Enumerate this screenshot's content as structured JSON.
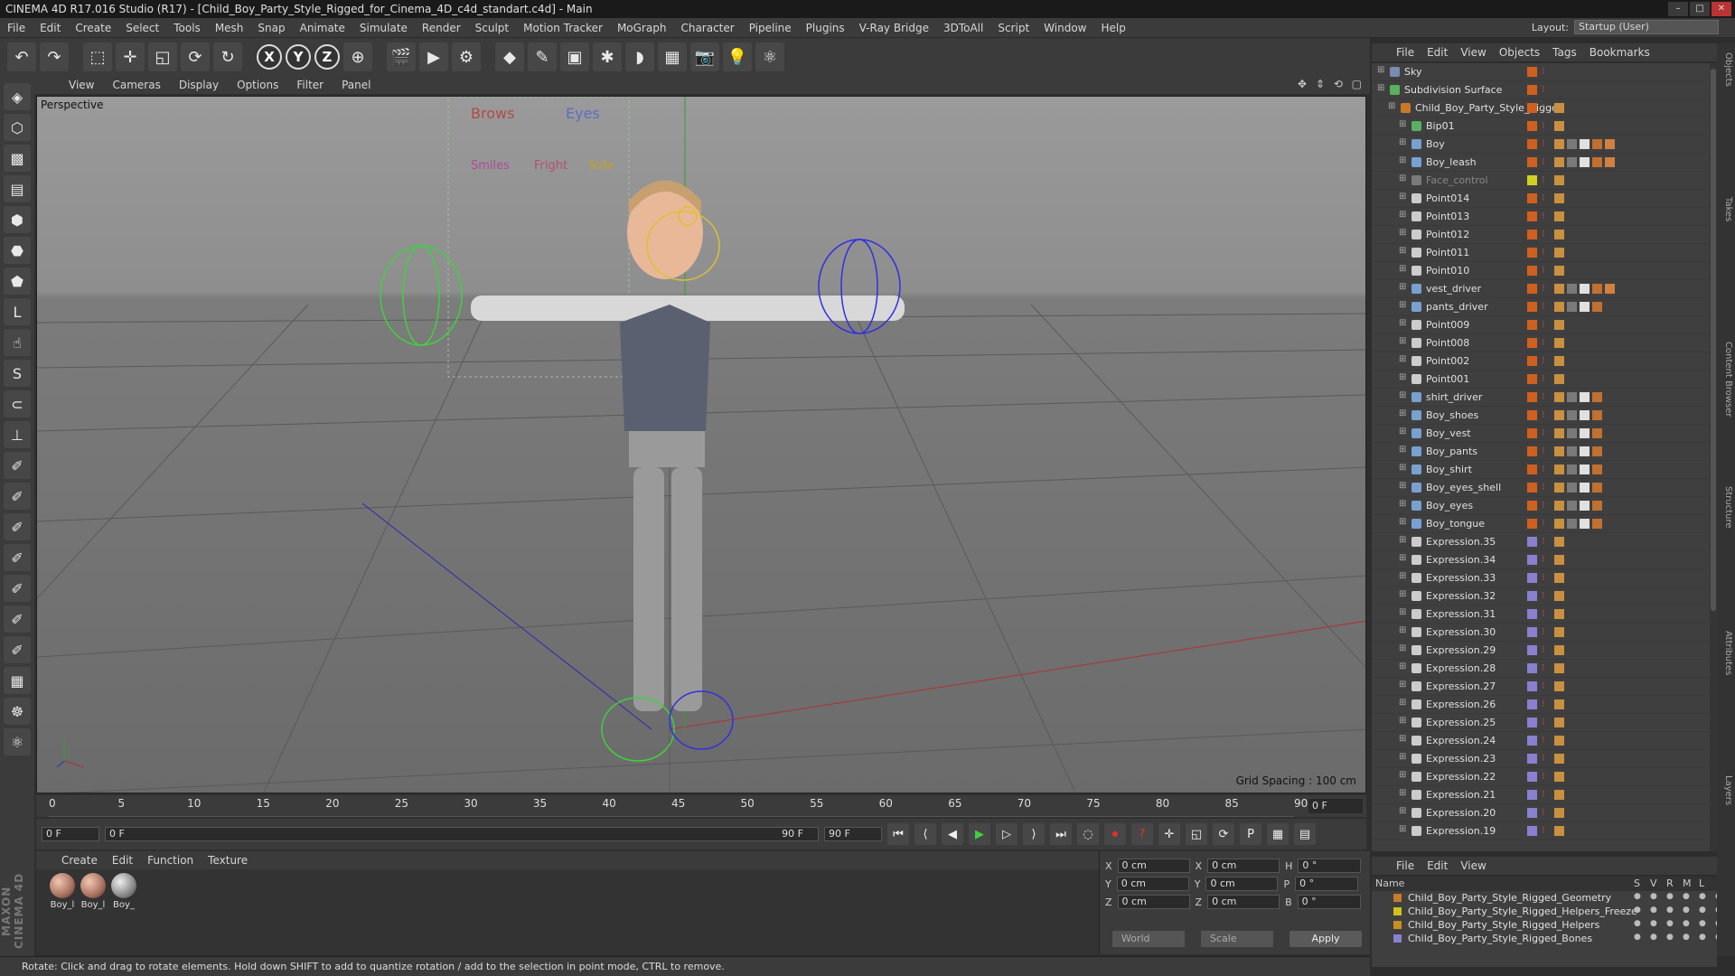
{
  "title": "CINEMA 4D R17.016 Studio (R17) - [Child_Boy_Party_Style_Rigged_for_Cinema_4D_c4d_standart.c4d] - Main",
  "menu": [
    "File",
    "Edit",
    "Create",
    "Select",
    "Tools",
    "Mesh",
    "Snap",
    "Animate",
    "Simulate",
    "Render",
    "Sculpt",
    "Motion Tracker",
    "MoGraph",
    "Character",
    "Pipeline",
    "Plugins",
    "V-Ray Bridge",
    "3DToAll",
    "Script",
    "Window",
    "Help"
  ],
  "layout": {
    "label": "Layout:",
    "value": "Startup (User)"
  },
  "viewport": {
    "menu": [
      "View",
      "Cameras",
      "Display",
      "Options",
      "Filter",
      "Panel"
    ],
    "label": "Perspective",
    "grid": "Grid Spacing : 100 cm",
    "rig_labels": {
      "brows": "Brows",
      "eyes": "Eyes",
      "smiles": "Smiles",
      "fright": "Fright",
      "side": "Side"
    }
  },
  "timeline": {
    "ticks": [
      "0",
      "5",
      "10",
      "15",
      "20",
      "25",
      "30",
      "35",
      "40",
      "45",
      "50",
      "55",
      "60",
      "65",
      "70",
      "75",
      "80",
      "85",
      "90"
    ],
    "current": "0 F"
  },
  "transport": {
    "start": "0 F",
    "range_start": "0 F",
    "range_end": "90 F",
    "end": "90 F"
  },
  "materials": {
    "menu": [
      "Create",
      "Edit",
      "Function",
      "Texture"
    ],
    "items": [
      {
        "label": "Boy_l"
      },
      {
        "label": "Boy_l"
      },
      {
        "label": "Boy_"
      }
    ]
  },
  "attributes": {
    "x": "0 cm",
    "y": "0 cm",
    "z": "0 cm",
    "x2": "0 cm",
    "y2": "0 cm",
    "z2": "0 cm",
    "h": "0 °",
    "p": "0 °",
    "b": "0 °",
    "coord": "World",
    "mode": "Scale",
    "apply": "Apply"
  },
  "status": "Rotate: Click and drag to rotate elements. Hold down SHIFT to add to quantize rotation / add to the selection in point mode, CTRL to remove.",
  "objects_menu": [
    "File",
    "Edit",
    "View",
    "Objects",
    "Tags",
    "Bookmarks"
  ],
  "objects": [
    {
      "name": "Sky",
      "indent": 0,
      "color": "#7a8ab0"
    },
    {
      "name": "Subdivision Surface",
      "indent": 0,
      "color": "#5ab060"
    },
    {
      "name": "Child_Boy_Party_Style_Rigged",
      "indent": 1,
      "color": "#c87a2a"
    },
    {
      "name": "Bip01",
      "indent": 2,
      "color": "#5ab060"
    },
    {
      "name": "Boy",
      "indent": 2,
      "color": "#7aa0d0"
    },
    {
      "name": "Boy_leash",
      "indent": 2,
      "color": "#7aa0d0"
    },
    {
      "name": "Face_control",
      "indent": 2,
      "color": "#7a7a7a"
    },
    {
      "name": "Point014",
      "indent": 2,
      "color": "#cccccc"
    },
    {
      "name": "Point013",
      "indent": 2,
      "color": "#cccccc"
    },
    {
      "name": "Point012",
      "indent": 2,
      "color": "#cccccc"
    },
    {
      "name": "Point011",
      "indent": 2,
      "color": "#cccccc"
    },
    {
      "name": "Point010",
      "indent": 2,
      "color": "#cccccc"
    },
    {
      "name": "vest_driver",
      "indent": 2,
      "color": "#7aa0d0"
    },
    {
      "name": "pants_driver",
      "indent": 2,
      "color": "#7aa0d0"
    },
    {
      "name": "Point009",
      "indent": 2,
      "color": "#cccccc"
    },
    {
      "name": "Point008",
      "indent": 2,
      "color": "#cccccc"
    },
    {
      "name": "Point002",
      "indent": 2,
      "color": "#cccccc"
    },
    {
      "name": "Point001",
      "indent": 2,
      "color": "#cccccc"
    },
    {
      "name": "shirt_driver",
      "indent": 2,
      "color": "#7aa0d0"
    },
    {
      "name": "Boy_shoes",
      "indent": 2,
      "color": "#7aa0d0"
    },
    {
      "name": "Boy_vest",
      "indent": 2,
      "color": "#7aa0d0"
    },
    {
      "name": "Boy_pants",
      "indent": 2,
      "color": "#7aa0d0"
    },
    {
      "name": "Boy_shirt",
      "indent": 2,
      "color": "#7aa0d0"
    },
    {
      "name": "Boy_eyes_shell",
      "indent": 2,
      "color": "#7aa0d0"
    },
    {
      "name": "Boy_eyes",
      "indent": 2,
      "color": "#7aa0d0"
    },
    {
      "name": "Boy_tongue",
      "indent": 2,
      "color": "#7aa0d0"
    },
    {
      "name": "Expression.35",
      "indent": 2,
      "color": "#cccccc"
    },
    {
      "name": "Expression.34",
      "indent": 2,
      "color": "#cccccc"
    },
    {
      "name": "Expression.33",
      "indent": 2,
      "color": "#cccccc"
    },
    {
      "name": "Expression.32",
      "indent": 2,
      "color": "#cccccc"
    },
    {
      "name": "Expression.31",
      "indent": 2,
      "color": "#cccccc"
    },
    {
      "name": "Expression.30",
      "indent": 2,
      "color": "#cccccc"
    },
    {
      "name": "Expression.29",
      "indent": 2,
      "color": "#cccccc"
    },
    {
      "name": "Expression.28",
      "indent": 2,
      "color": "#cccccc"
    },
    {
      "name": "Expression.27",
      "indent": 2,
      "color": "#cccccc"
    },
    {
      "name": "Expression.26",
      "indent": 2,
      "color": "#cccccc"
    },
    {
      "name": "Expression.25",
      "indent": 2,
      "color": "#cccccc"
    },
    {
      "name": "Expression.24",
      "indent": 2,
      "color": "#cccccc"
    },
    {
      "name": "Expression.23",
      "indent": 2,
      "color": "#cccccc"
    },
    {
      "name": "Expression.22",
      "indent": 2,
      "color": "#cccccc"
    },
    {
      "name": "Expression.21",
      "indent": 2,
      "color": "#cccccc"
    },
    {
      "name": "Expression.20",
      "indent": 2,
      "color": "#cccccc"
    },
    {
      "name": "Expression.19",
      "indent": 2,
      "color": "#cccccc"
    }
  ],
  "layers_menu": [
    "File",
    "Edit",
    "View"
  ],
  "layers_cols": {
    "name": "Name",
    "s": "S",
    "v": "V",
    "r": "R",
    "m": "M",
    "l": "L"
  },
  "layers": [
    {
      "name": "Child_Boy_Party_Style_Rigged_Geometry",
      "color": "#c87a2a"
    },
    {
      "name": "Child_Boy_Party_Style_Rigged_Helpers_Freeze",
      "color": "#d0c020"
    },
    {
      "name": "Child_Boy_Party_Style_Rigged_Helpers",
      "color": "#c89020"
    },
    {
      "name": "Child_Boy_Party_Style_Rigged_Bones",
      "color": "#8a80d0"
    }
  ],
  "vtabs": [
    "Objects",
    "Takes",
    "Content Browser",
    "Structure",
    "Attributes",
    "Layers"
  ],
  "brand": "MAXON CINEMA 4D"
}
